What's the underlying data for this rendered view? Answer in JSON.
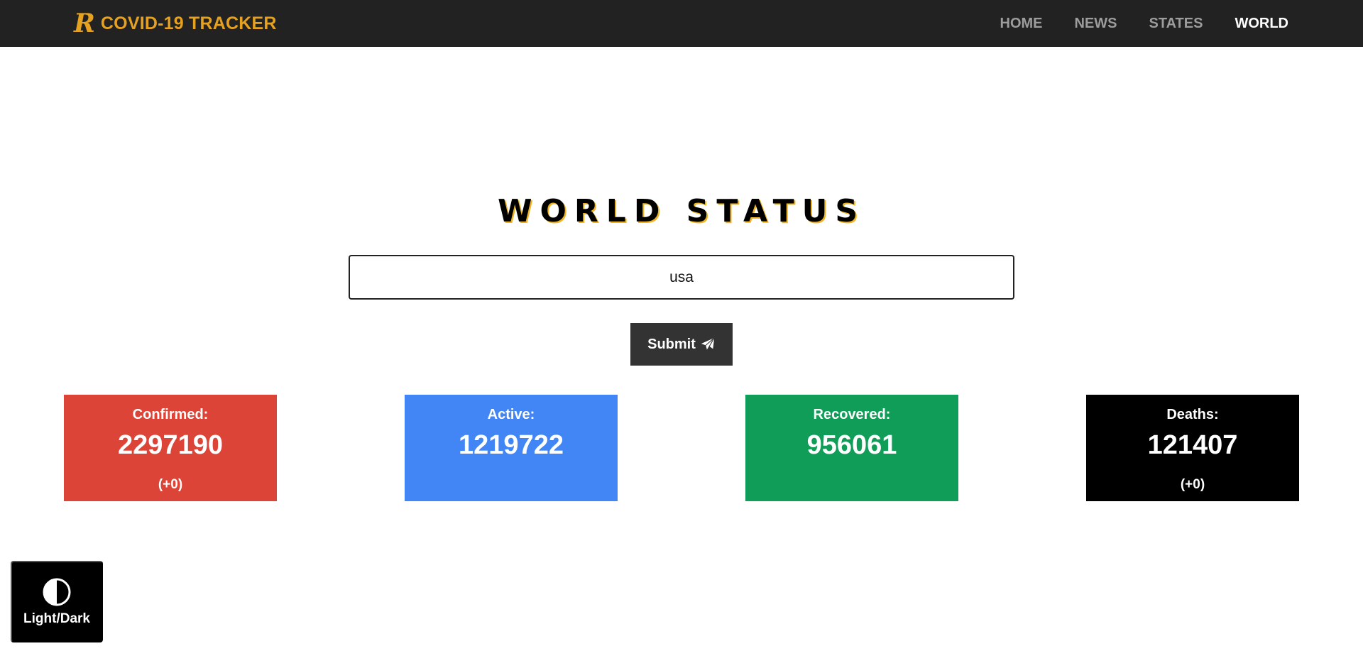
{
  "navbar": {
    "brand_logo": "R",
    "brand_title": "COVID-19 TRACKER",
    "links": [
      {
        "label": "HOME",
        "active": false
      },
      {
        "label": "NEWS",
        "active": false
      },
      {
        "label": "STATES",
        "active": false
      },
      {
        "label": "WORLD",
        "active": true
      }
    ]
  },
  "main": {
    "title": "WORLD STATUS",
    "search_value": "usa",
    "submit_label": "Submit",
    "submit_icon": "paper-plane-icon"
  },
  "stats": [
    {
      "label": "Confirmed:",
      "value": "2297190",
      "delta": "(+0)",
      "color": "#db4437"
    },
    {
      "label": "Active:",
      "value": "1219722",
      "delta": "",
      "color": "#4285f4"
    },
    {
      "label": "Recovered:",
      "value": "956061",
      "delta": "",
      "color": "#0f9d58"
    },
    {
      "label": "Deaths:",
      "value": "121407",
      "delta": "(+0)",
      "color": "#000000"
    }
  ],
  "theme_toggle": {
    "label": "Light/Dark",
    "icon": "contrast-icon"
  },
  "colors": {
    "navbar_bg": "#222222",
    "brand_accent": "#e5a11f",
    "nav_inactive": "#9d9d9d",
    "title_shadow": "#f0b323",
    "button_bg": "#333333"
  }
}
